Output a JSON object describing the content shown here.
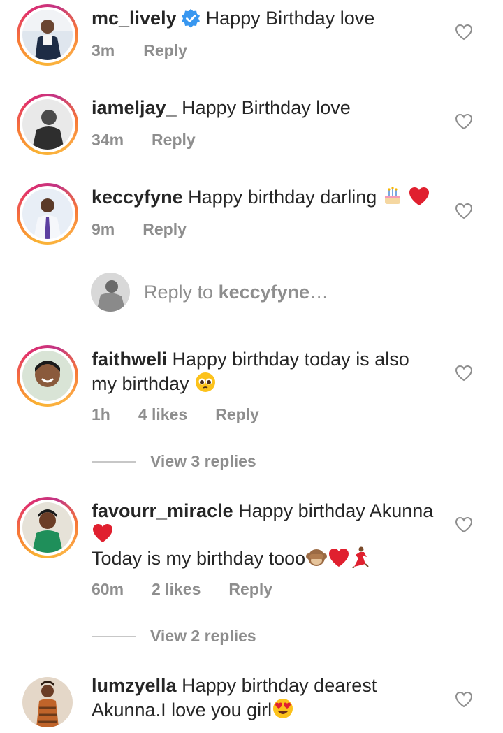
{
  "comments": [
    {
      "username": "mc_lively",
      "text": "Happy Birthday love",
      "time": "3m",
      "reply": "Reply",
      "verified": true
    },
    {
      "username": "iameljay_",
      "text": "Happy Birthday love",
      "time": "34m",
      "reply": "Reply"
    },
    {
      "username": "keccyfyne",
      "text": "Happy birthday darling",
      "time": "9m",
      "reply": "Reply"
    },
    {
      "username": "faithweli",
      "text": "Happy birthday today is also",
      "text2": "my birthday",
      "time": "1h",
      "likes": "4 likes",
      "reply": "Reply",
      "view_replies": "View 3 replies"
    },
    {
      "username": "favourr_miracle",
      "text": "Happy birthday Akunna",
      "text2": "Today is my birthday tooo",
      "time": "60m",
      "likes": "2 likes",
      "reply": "Reply",
      "view_replies": "View 2 replies"
    },
    {
      "username": "lumzyella",
      "text": "Happy birthday dearest",
      "text2": "Akunna.I love you girl"
    }
  ],
  "reply_to": {
    "prefix": "Reply to ",
    "username": "keccyfyne",
    "suffix": "…"
  },
  "colors": {
    "secondary_text": "#8e8e8e",
    "primary_text": "#262626",
    "verified": "#3897f0",
    "heart_red": "#e0202f"
  }
}
